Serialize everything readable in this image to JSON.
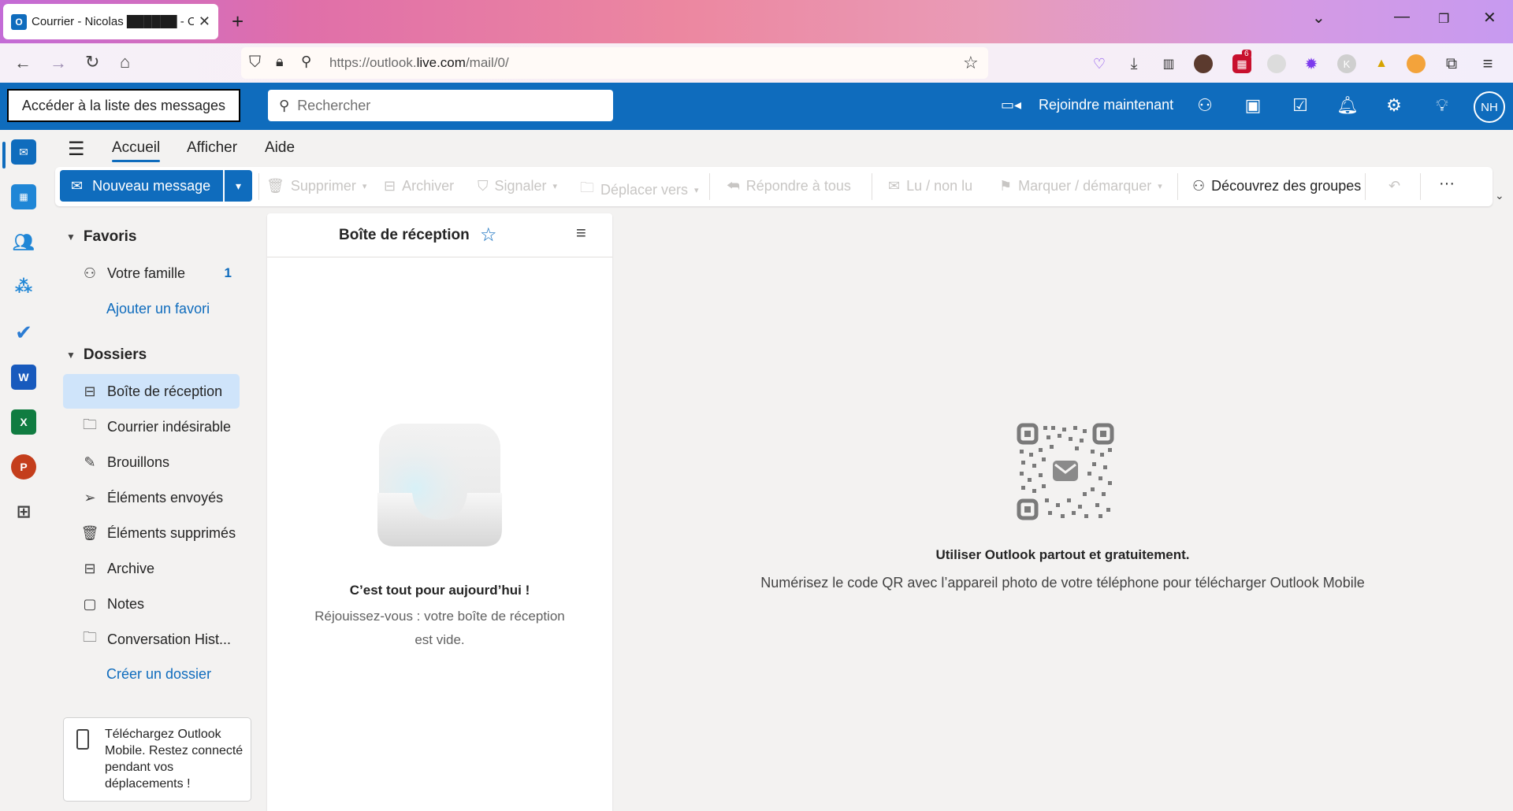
{
  "browser": {
    "tab_title": "Courrier - Nicolas ██████ - Outl",
    "tab_favicon": "O",
    "url_prefix": "https://outlook.",
    "url_domain": "live.com",
    "url_path": "/mail/0/",
    "extension_badge": "6",
    "extension_letter": "K"
  },
  "header": {
    "skip_label": "Accéder à la liste des messages",
    "search_placeholder": "Rechercher",
    "join_label": "Rejoindre maintenant",
    "avatar_initials": "NH"
  },
  "rail": {
    "word_letter": "W",
    "excel_letter": "X",
    "powerpoint_letter": "P"
  },
  "ribbon_tabs": [
    {
      "label": "Accueil"
    },
    {
      "label": "Afficher"
    },
    {
      "label": "Aide"
    }
  ],
  "toolbar": {
    "new_message": "Nouveau message",
    "delete": "Supprimer",
    "archive": "Archiver",
    "report": "Signaler",
    "move_to": "Déplacer vers",
    "reply_all": "Répondre à tous",
    "read_unread": "Lu / non lu",
    "flag": "Marquer / démarquer",
    "groups": "Découvrez des groupes",
    "more": "···"
  },
  "folders": {
    "favorites_header": "Favoris",
    "favorites": [
      {
        "label": "Votre famille",
        "count": "1"
      }
    ],
    "add_favorite": "Ajouter un favori",
    "folders_header": "Dossiers",
    "items": [
      {
        "label": "Boîte de réception"
      },
      {
        "label": "Courrier indésirable"
      },
      {
        "label": "Brouillons"
      },
      {
        "label": "Éléments envoyés"
      },
      {
        "label": "Éléments supprimés"
      },
      {
        "label": "Archive"
      },
      {
        "label": "Notes"
      },
      {
        "label": "Conversation Hist..."
      }
    ],
    "create_folder": "Créer un dossier",
    "promo": "Téléchargez Outlook Mobile. Restez connecté pendant vos déplacements !"
  },
  "message_list": {
    "title": "Boîte de réception",
    "empty_title": "C’est tout pour aujourd’hui !",
    "empty_subtitle": "Réjouissez-vous : votre boîte de réception est vide."
  },
  "reading_pane": {
    "title": "Utiliser Outlook partout et gratuitement.",
    "subtitle": "Numérisez le code QR avec l’appareil photo de votre téléphone pour télécharger Outlook Mobile"
  },
  "colors": {
    "brand": "#0f6cbd",
    "selected": "#cfe4fa",
    "disabled": "#c8c6c4"
  }
}
